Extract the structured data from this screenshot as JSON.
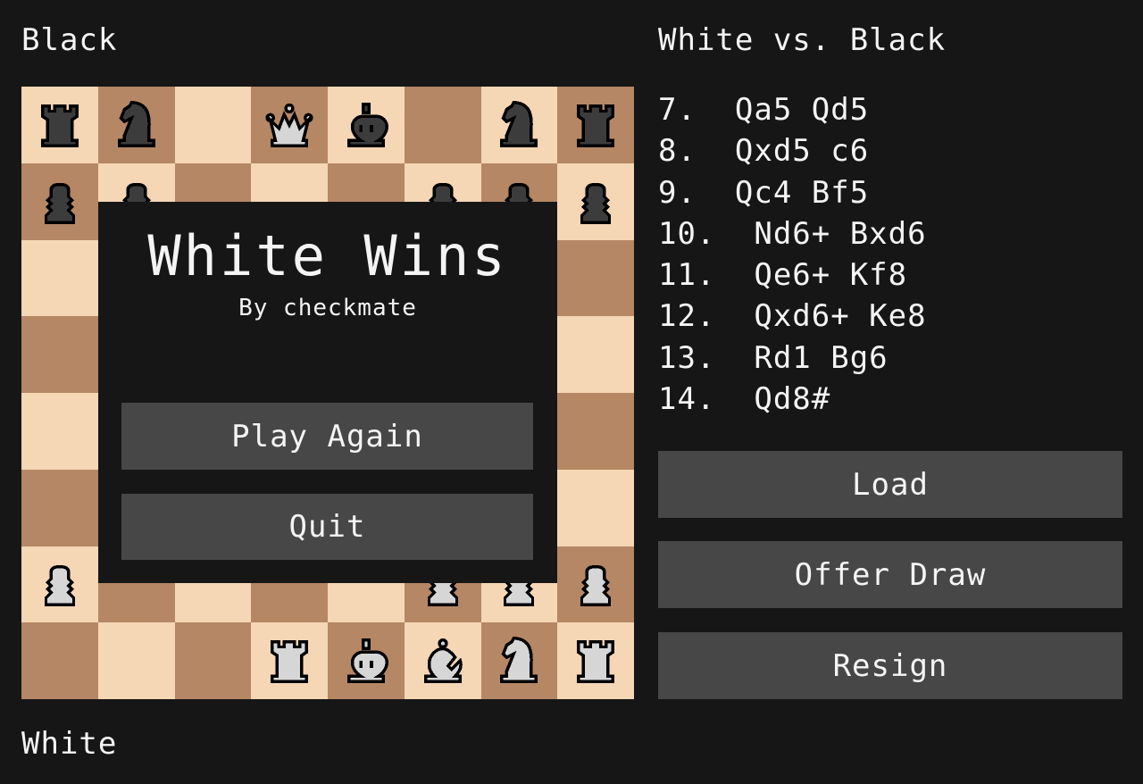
{
  "labels": {
    "top_player": "Black",
    "bottom_player": "White",
    "game_title": "White vs. Black"
  },
  "colors": {
    "background": "#161616",
    "light_square": "#f5d6b5",
    "dark_square": "#b58765",
    "button": "#474747",
    "white_piece": "#d6d6d6",
    "black_piece": "#3c3c3c"
  },
  "board": {
    "orientation": "white-bottom",
    "ranks": [
      [
        "bR",
        "bN",
        "",
        "wQ",
        "bK",
        "",
        "bN",
        "bR"
      ],
      [
        "bP",
        "bP",
        "",
        "",
        "",
        "bP",
        "bP",
        "bP"
      ],
      [
        "",
        "",
        "",
        "",
        "",
        "",
        "",
        ""
      ],
      [
        "",
        "",
        "",
        "",
        "",
        "",
        "",
        ""
      ],
      [
        "",
        "",
        "",
        "",
        "",
        "",
        "",
        ""
      ],
      [
        "",
        "",
        "",
        "",
        "",
        "",
        "",
        ""
      ],
      [
        "wP",
        "",
        "",
        "",
        "",
        "wP",
        "wP",
        "wP"
      ],
      [
        "",
        "",
        "",
        "wR",
        "wK",
        "wB",
        "wN",
        "wR"
      ]
    ]
  },
  "modal": {
    "title": "White Wins",
    "subtitle": "By checkmate",
    "play_again_label": "Play Again",
    "quit_label": "Quit"
  },
  "moves": [
    "7.  Qa5 Qd5",
    "8.  Qxd5 c6",
    "9.  Qc4 Bf5",
    "10.  Nd6+ Bxd6",
    "11.  Qe6+ Kf8",
    "12.  Qxd6+ Ke8",
    "13.  Rd1 Bg6",
    "14.  Qd8#"
  ],
  "actions": {
    "load_label": "Load",
    "offer_draw_label": "Offer Draw",
    "resign_label": "Resign"
  }
}
